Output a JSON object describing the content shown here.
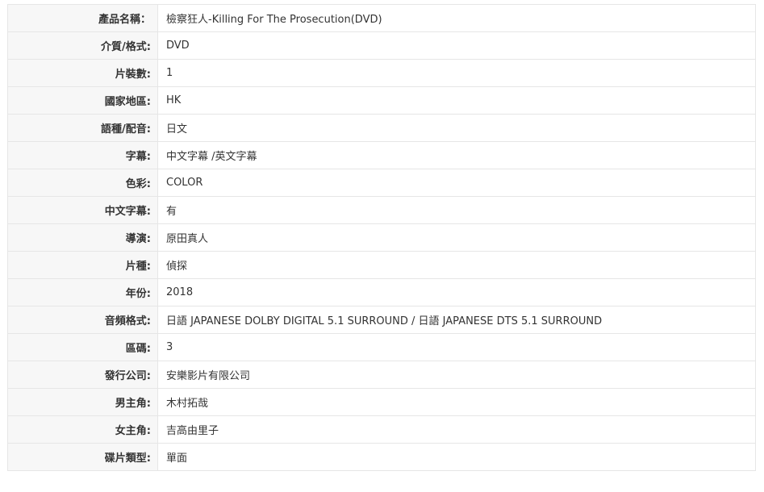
{
  "product_specs": [
    {
      "label": "產品名稱：",
      "value": "檢察狂人-Killing For The Prosecution(DVD)"
    },
    {
      "label": "介質/格式:",
      "value": "DVD"
    },
    {
      "label": "片裝數:",
      "value": "1"
    },
    {
      "label": "國家地區:",
      "value": "HK"
    },
    {
      "label": "語種/配音:",
      "value": "日文"
    },
    {
      "label": "字幕:",
      "value": "中文字幕 /英文字幕"
    },
    {
      "label": "色彩:",
      "value": "COLOR"
    },
    {
      "label": "中文字幕:",
      "value": "有"
    },
    {
      "label": "導演:",
      "value": "原田真人"
    },
    {
      "label": "片種:",
      "value": "偵探"
    },
    {
      "label": "年份:",
      "value": "2018"
    },
    {
      "label": "音頻格式:",
      "value": "日語 JAPANESE DOLBY DIGITAL 5.1 SURROUND / 日語 JAPANESE DTS 5.1 SURROUND"
    },
    {
      "label": "區碼:",
      "value": "3"
    },
    {
      "label": "發行公司:",
      "value": "安樂影片有限公司"
    },
    {
      "label": "男主角:",
      "value": "木村拓哉"
    },
    {
      "label": "女主角:",
      "value": "吉高由里子"
    },
    {
      "label": "碟片類型:",
      "value": "單面"
    }
  ]
}
